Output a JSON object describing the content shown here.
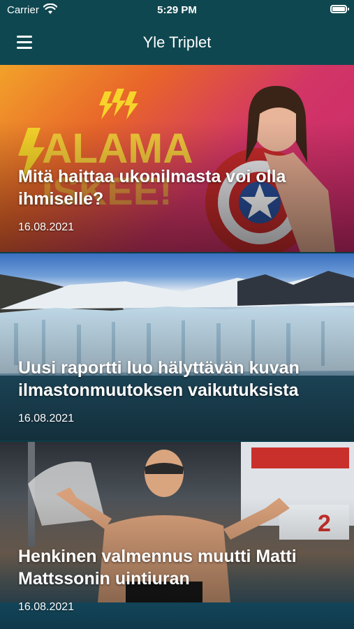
{
  "status_bar": {
    "carrier": "Carrier",
    "time": "5:29 PM"
  },
  "nav": {
    "title": "Yle Triplet"
  },
  "articles": [
    {
      "title": "Mitä haittaa ukonilmasta voi olla ihmiselle?",
      "date": "16.08.2021"
    },
    {
      "title": "Uusi raportti luo hälyttävän kuvan ilmastonmuutoksen vaikutuksista",
      "date": "16.08.2021"
    },
    {
      "title": "Henkinen valmennus muutti Matti Mattssonin uintiuran",
      "date": "16.08.2021"
    }
  ],
  "colors": {
    "header_bg": "#0f4750",
    "text": "#ffffff"
  }
}
